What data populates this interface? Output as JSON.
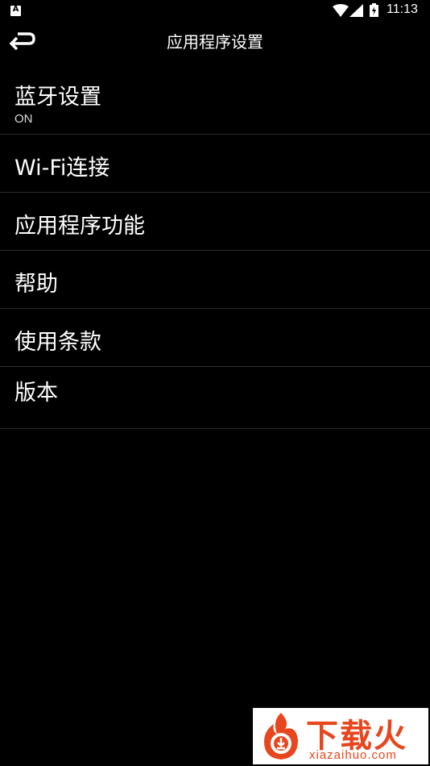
{
  "status_bar": {
    "notification_icon": "notification-a-icon",
    "notification_glyph": "A",
    "time": "11:13"
  },
  "app_bar": {
    "back_icon": "back-arrow-icon",
    "title": "应用程序设置"
  },
  "settings": [
    {
      "title": "蓝牙设置",
      "subtitle": "ON"
    },
    {
      "title": "Wi-Fi连接"
    },
    {
      "title": "应用程序功能"
    },
    {
      "title": "帮助"
    },
    {
      "title": "使用条款"
    },
    {
      "title": "版本"
    }
  ],
  "watermark": {
    "text": "下载火",
    "domain": "xiazaihuo.com",
    "color": "#e8461e"
  }
}
